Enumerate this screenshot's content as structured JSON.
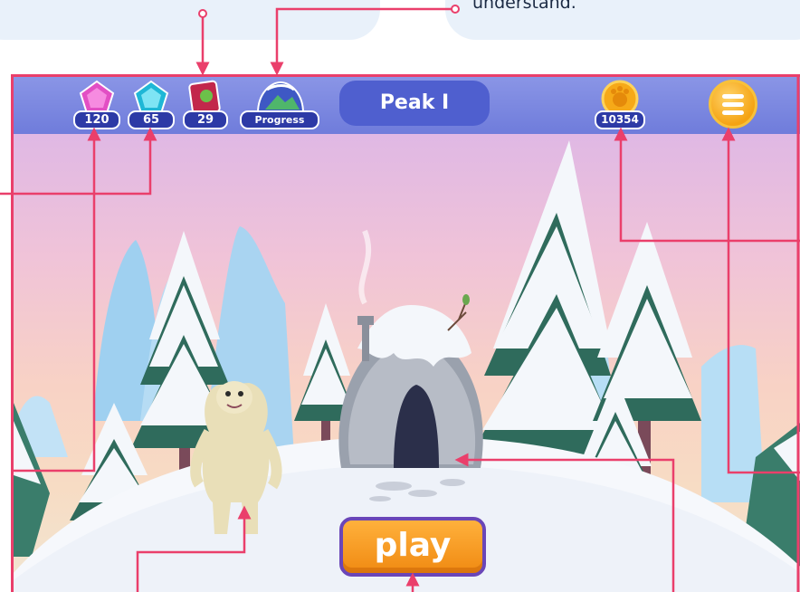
{
  "callouts": {
    "right_card_text": "understand."
  },
  "hud": {
    "pink_gems": "120",
    "blue_gems": "65",
    "books": "29",
    "progress_label": "Progress",
    "level_title": "Peak I",
    "coins": "10354"
  },
  "play_label": "play",
  "colors": {
    "annotation": "#ea3f6b",
    "topbar": "#7a86e0",
    "pill": "#2d3aa6",
    "play": "#f59a22",
    "menu": "#f5a313"
  }
}
